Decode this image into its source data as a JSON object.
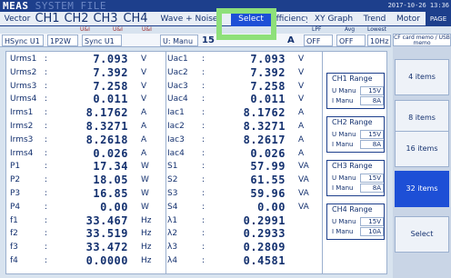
{
  "header": {
    "brand": "MEAS",
    "brand_dim": "SYSTEM FILE",
    "datetime": "2017-10-26 13:36"
  },
  "tabs": [
    "Vector",
    "CH1",
    "CH2",
    "CH3",
    "CH4",
    "Wave + Noise",
    "Select",
    "Efficiency",
    "XY Graph",
    "Trend",
    "Motor",
    "PAGE"
  ],
  "indicators": {
    "ch1": "U&I",
    "ch2": "U&I",
    "ch4": "U&I",
    "lpf": "LPF",
    "avg": "Avg",
    "lowest": "Lowest"
  },
  "settings": {
    "hsync": "HSync U1",
    "wiring": "1P2W",
    "sync": "Sync U1",
    "u_manu": "U: Manu",
    "u_range": "15",
    "a_unit": "A",
    "lpf": "OFF",
    "avg": "OFF",
    "lowest": "10Hz"
  },
  "sidebar": {
    "sdcard": "CF card memo / USB memo",
    "keys": [
      "4 items",
      "8 items",
      "16 items",
      "32 items",
      "Select"
    ]
  },
  "col1": [
    {
      "name": "Urms1",
      "value": "7.093",
      "unit": "V"
    },
    {
      "name": "Urms2",
      "value": "7.392",
      "unit": "V"
    },
    {
      "name": "Urms3",
      "value": "7.258",
      "unit": "V"
    },
    {
      "name": "Urms4",
      "value": "0.011",
      "unit": "V"
    },
    {
      "name": "Irms1",
      "value": "8.1762",
      "unit": "A"
    },
    {
      "name": "Irms2",
      "value": "8.3271",
      "unit": "A"
    },
    {
      "name": "Irms3",
      "value": "8.2618",
      "unit": "A"
    },
    {
      "name": "Irms4",
      "value": "0.026",
      "unit": "A"
    },
    {
      "name": "P1",
      "value": "17.34",
      "unit": "W"
    },
    {
      "name": "P2",
      "value": "18.05",
      "unit": "W"
    },
    {
      "name": "P3",
      "value": "16.85",
      "unit": "W"
    },
    {
      "name": "P4",
      "value": "0.00",
      "unit": "W"
    },
    {
      "name": "f1",
      "value": "33.467",
      "unit": "Hz"
    },
    {
      "name": "f2",
      "value": "33.519",
      "unit": "Hz"
    },
    {
      "name": "f3",
      "value": "33.472",
      "unit": "Hz"
    },
    {
      "name": "f4",
      "value": "0.0000",
      "unit": "Hz"
    }
  ],
  "col2": [
    {
      "name": "Uac1",
      "value": "7.093",
      "unit": "V"
    },
    {
      "name": "Uac2",
      "value": "7.392",
      "unit": "V"
    },
    {
      "name": "Uac3",
      "value": "7.258",
      "unit": "V"
    },
    {
      "name": "Uac4",
      "value": "0.011",
      "unit": "V"
    },
    {
      "name": "Iac1",
      "value": "8.1762",
      "unit": "A"
    },
    {
      "name": "Iac2",
      "value": "8.3271",
      "unit": "A"
    },
    {
      "name": "Iac3",
      "value": "8.2617",
      "unit": "A"
    },
    {
      "name": "Iac4",
      "value": "0.026",
      "unit": "A"
    },
    {
      "name": "S1",
      "value": "57.99",
      "unit": "VA"
    },
    {
      "name": "S2",
      "value": "61.55",
      "unit": "VA"
    },
    {
      "name": "S3",
      "value": "59.96",
      "unit": "VA"
    },
    {
      "name": "S4",
      "value": "0.00",
      "unit": "VA"
    },
    {
      "name": "λ1",
      "value": "0.2991",
      "unit": ""
    },
    {
      "name": "λ2",
      "value": "0.2933",
      "unit": ""
    },
    {
      "name": "λ3",
      "value": "0.2809",
      "unit": ""
    },
    {
      "name": "λ4",
      "value": "0.4581",
      "unit": ""
    }
  ],
  "ranges": [
    {
      "title": "CH1 Range",
      "u_label": "U Manu",
      "u_val": "15V",
      "i_label": "I Manu",
      "i_val": "8A"
    },
    {
      "title": "CH2 Range",
      "u_label": "U Manu",
      "u_val": "15V",
      "i_label": "I Manu",
      "i_val": "8A"
    },
    {
      "title": "CH3 Range",
      "u_label": "U Manu",
      "u_val": "15V",
      "i_label": "I Manu",
      "i_val": "8A"
    },
    {
      "title": "CH4 Range",
      "u_label": "U Manu",
      "u_val": "15V",
      "i_label": "I Manu",
      "i_val": "10A"
    }
  ],
  "colon": ":"
}
